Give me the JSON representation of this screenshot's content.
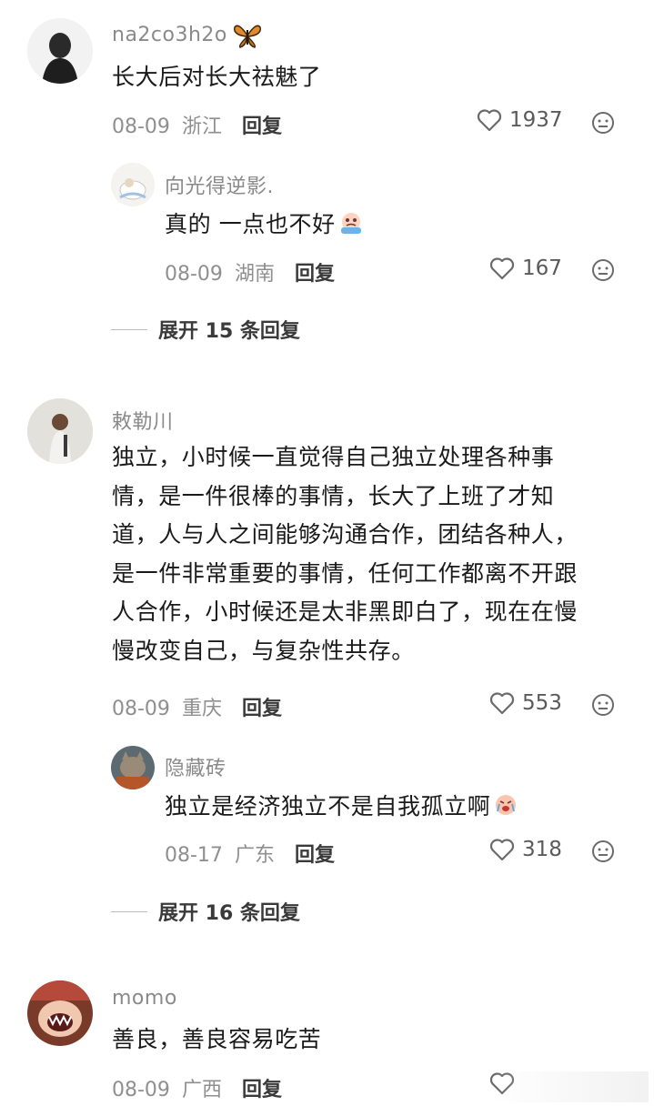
{
  "comments": [
    {
      "username": "na2co3h2o",
      "text": "长大后对长大祛魅了",
      "date": "08-09",
      "location": "浙江",
      "reply_label": "回复",
      "likes": "1937",
      "replies": [
        {
          "username": "向光得逆影.",
          "text": "真的 一点也不好",
          "date": "08-09",
          "location": "湖南",
          "reply_label": "回复",
          "likes": "167"
        }
      ],
      "expand_label": "展开 15 条回复"
    },
    {
      "username": "敕勒川",
      "text_lines": [
        "独立，小时候一直觉得自己独立处理各种事",
        "情，是一件很棒的事情，长大了上班了才知",
        "道，人与人之间能够沟通合作，团结各种人，",
        "是一件非常重要的事情，任何工作都离不开跟",
        "人合作，小时候还是太非黑即白了，现在在慢",
        "慢改变自己，与复杂性共存。"
      ],
      "date": "08-09",
      "location": "重庆",
      "reply_label": "回复",
      "likes": "553",
      "replies": [
        {
          "username": "隐藏砖",
          "text": "独立是经济独立不是自我孤立啊",
          "date": "08-17",
          "location": "广东",
          "reply_label": "回复",
          "likes": "318"
        }
      ],
      "expand_label": "展开 16 条回复"
    },
    {
      "username": "momo",
      "text": "善良，善良容易吃苦",
      "date": "08-09",
      "location": "广西",
      "reply_label": "回复"
    }
  ],
  "icons": {
    "like": "heart-outline-icon",
    "react": "emoji-face-icon",
    "badge": "butterfly-icon"
  },
  "colors": {
    "username": "#8a8a8a",
    "text": "#1a1a1a",
    "meta": "#8f8f8f"
  }
}
